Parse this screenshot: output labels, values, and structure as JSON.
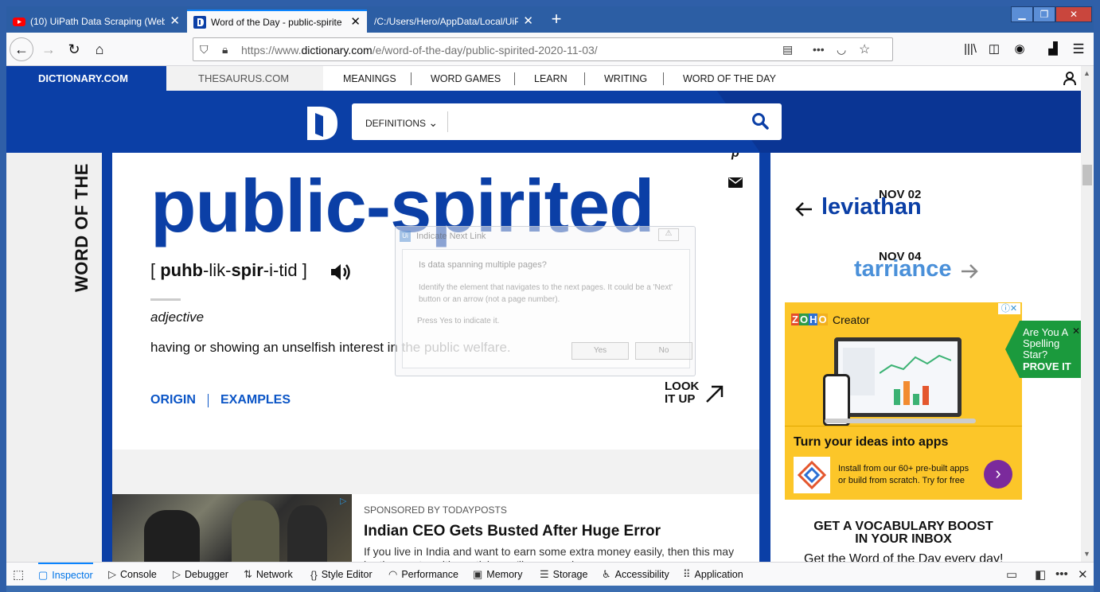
{
  "browser": {
    "tabs": [
      {
        "title": "(10) UiPath Data Scraping (Web",
        "icon": "youtube-icon",
        "active": false
      },
      {
        "title": "Word of the Day - public-spirite",
        "icon": "dictionary-icon",
        "active": true
      },
      {
        "title": "/C:/Users/Hero/AppData/Local/UiP",
        "icon": "",
        "active": false
      }
    ],
    "url_prefix": "https://www.",
    "url_domain": "dictionary.com",
    "url_path": "/e/word-of-the-day/public-spirited-2020-11-03/"
  },
  "site": {
    "brand": "DICTIONARY.COM",
    "thesaurus": "THESAURUS.COM",
    "nav": [
      "MEANINGS",
      "WORD GAMES",
      "LEARN",
      "WRITING",
      "WORD OF THE DAY"
    ],
    "search_mode": "DEFINITIONS",
    "search_placeholder": ""
  },
  "word_of_day": {
    "vertical_title": "WORD OF THE",
    "word": "public-spirited",
    "pron_open": "[ ",
    "pron_s1": "puhb",
    "pron_s2": "-lik-",
    "pron_s3": "spir",
    "pron_s4": "-i-tid",
    "pron_close": " ]",
    "part_of_speech": "adjective",
    "definition": "having or showing an unselfish interest in the public welfare.",
    "origin_label": "ORIGIN",
    "examples_label": "EXAMPLES",
    "lookup_line1": "LOOK",
    "lookup_line2": "IT UP",
    "pin_glyph": "p"
  },
  "sidebar_nav": {
    "prev_date": "NOV 02",
    "prev_word": "leviathan",
    "next_date": "NOV 04",
    "next_word": "tarriance"
  },
  "ad": {
    "brand_z": "Z",
    "brand_o1": "O",
    "brand_h": "H",
    "brand_o2": "O",
    "product": "Creator",
    "headline": "Turn your ideas into apps",
    "copy_line1": "Install from our 60+ pre-built apps",
    "copy_line2": "or build from scratch. Try for free",
    "info_glyph": "ⓘ✕"
  },
  "spelling_ad": {
    "line1": "Are You A",
    "line2": "Spelling",
    "line3": "Star?",
    "cta": "PROVE IT",
    "close": "✕"
  },
  "sponsored": {
    "label": "SPONSORED BY TODAYPOSTS",
    "title": "Indian CEO Gets Busted After Huge Error",
    "body": "If you live in India and want to earn some extra money easily, then this may be the most exciting article you'll ever read."
  },
  "vocab": {
    "title_line1": "GET A VOCABULARY BOOST",
    "title_line2": "IN YOUR INBOX",
    "subtitle": "Get the Word of the Day every day!"
  },
  "uipath_dialog": {
    "title": "Indicate Next Link",
    "question": "Is data spanning multiple pages?",
    "description": "Identify the element that navigates to the next pages. It could be a 'Next' button or an arrow (not a page number).",
    "press": "Press Yes to indicate it.",
    "yes": "Yes",
    "no": "No",
    "help": "⚠"
  },
  "devtools": {
    "tabs": [
      "Inspector",
      "Console",
      "Debugger",
      "Network",
      "Style Editor",
      "Performance",
      "Memory",
      "Storage",
      "Accessibility",
      "Application"
    ],
    "active_tab": "Inspector"
  },
  "colors": {
    "brand_blue": "#0b3fa6",
    "link_blue": "#0b55c6",
    "next_word_blue": "#4a90d9",
    "ad_yellow": "#fcc629",
    "spelling_green": "#1b9a3d"
  }
}
